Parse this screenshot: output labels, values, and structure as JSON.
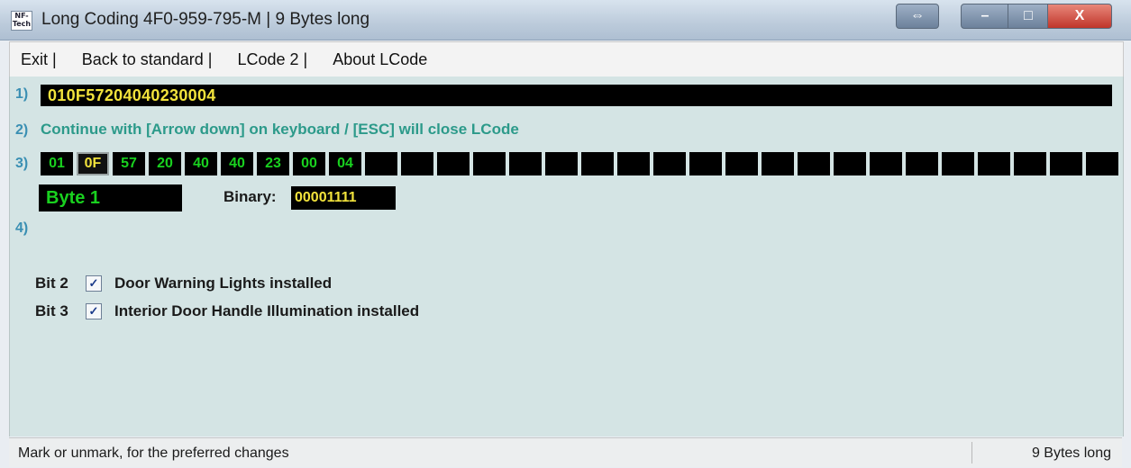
{
  "window": {
    "title": "Long Coding  4F0-959-795-M | 9 Bytes long",
    "icon": "app-logo-icon",
    "icon_text": "NF-Tech",
    "controls": {
      "resize": "⇔",
      "minimize": "–",
      "maximize": "□",
      "close": "X"
    }
  },
  "menu": [
    "Exit |",
    "Back to standard |",
    "LCode 2 |",
    "About LCode"
  ],
  "rows": {
    "r1": "1)",
    "r2": "2)",
    "r3": "3)",
    "r4": "4)"
  },
  "coding": {
    "value": "010F57204040230004"
  },
  "hint": "Continue with [Arrow down] on keyboard / [ESC] will close LCode",
  "bytes": [
    "01",
    "0F",
    "57",
    "20",
    "40",
    "40",
    "23",
    "00",
    "04"
  ],
  "selected_byte_index": 1,
  "empty_byte_slots": 21,
  "byte_info": {
    "label": "Byte 1",
    "binary_label": "Binary:",
    "binary_value": "00001111"
  },
  "bits": [
    {
      "label": "Bit 2",
      "checked": true,
      "mark": "✓",
      "description": "Door Warning Lights installed"
    },
    {
      "label": "Bit 3",
      "checked": true,
      "mark": "✓",
      "description": "Interior Door Handle Illumination installed"
    }
  ],
  "status": {
    "left": "Mark or unmark, for the preferred changes",
    "right": "9 Bytes long"
  },
  "colors": {
    "client_bg": "#d4e4e4",
    "code_text": "#f2e33c",
    "byte_text": "#19d11f",
    "hint_text": "#2c9a8a",
    "row_number": "#3a8fb3"
  }
}
